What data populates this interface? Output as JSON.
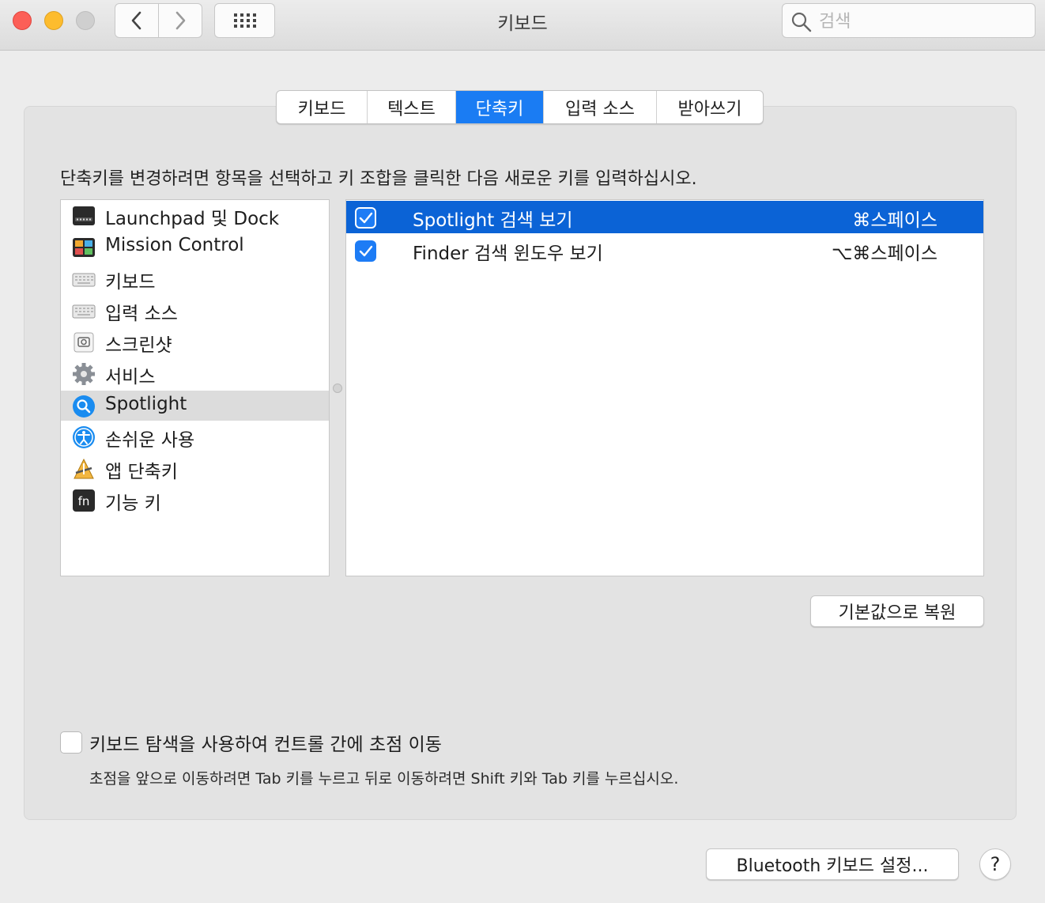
{
  "window": {
    "title": "키보드",
    "search_placeholder": "검색"
  },
  "tabs": [
    {
      "label": "키보드",
      "active": false
    },
    {
      "label": "텍스트",
      "active": false
    },
    {
      "label": "단축키",
      "active": true
    },
    {
      "label": "입력 소스",
      "active": false
    },
    {
      "label": "받아쓰기",
      "active": false
    }
  ],
  "instruction": "단축키를 변경하려면 항목을 선택하고 키 조합을 클릭한 다음 새로운 키를 입력하십시오.",
  "categories": [
    {
      "label": "Launchpad 및 Dock",
      "icon": "launchpad-dock-icon"
    },
    {
      "label": "Mission Control",
      "icon": "mission-control-icon"
    },
    {
      "label": "키보드",
      "icon": "keyboard-icon"
    },
    {
      "label": "입력 소스",
      "icon": "keyboard-icon"
    },
    {
      "label": "스크린샷",
      "icon": "screenshot-icon"
    },
    {
      "label": "서비스",
      "icon": "gear-icon"
    },
    {
      "label": "Spotlight",
      "icon": "spotlight-icon",
      "selected": true
    },
    {
      "label": "손쉬운 사용",
      "icon": "accessibility-icon"
    },
    {
      "label": "앱 단축키",
      "icon": "app-shortcuts-icon"
    },
    {
      "label": "기능 키",
      "icon": "fn-key-icon"
    }
  ],
  "shortcuts": [
    {
      "name": "Spotlight 검색 보기",
      "keys": "⌘스페이스",
      "checked": true,
      "selected": true
    },
    {
      "name": "Finder 검색 윈도우 보기",
      "keys": "⌥⌘스페이스",
      "checked": true,
      "selected": false
    }
  ],
  "buttons": {
    "restore": "기본값으로 복원",
    "bluetooth": "Bluetooth 키보드 설정...",
    "help": "?"
  },
  "keyboard_navigation": {
    "label": "키보드 탐색을 사용하여 컨트롤 간에 초점 이동",
    "hint": "초점을 앞으로 이동하려면 Tab 키를 누르고 뒤로 이동하려면 Shift 키와 Tab 키를 누르십시오.",
    "checked": false
  },
  "colors": {
    "accent": "#1a7cf3",
    "selection": "#0b63d6",
    "close": "#fc5f57",
    "minimize": "#fdbc2e"
  }
}
